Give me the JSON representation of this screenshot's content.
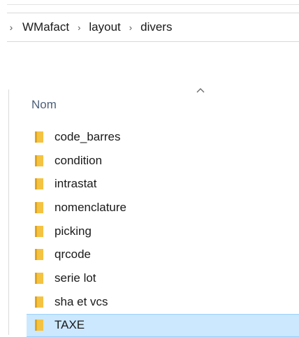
{
  "breadcrumb": {
    "items": [
      {
        "label": "WMafact"
      },
      {
        "label": "layout"
      },
      {
        "label": "divers"
      }
    ]
  },
  "column": {
    "name_header": "Nom"
  },
  "folders": [
    {
      "name": "code_barres",
      "selected": false
    },
    {
      "name": "condition",
      "selected": false
    },
    {
      "name": "intrastat",
      "selected": false
    },
    {
      "name": "nomenclature",
      "selected": false
    },
    {
      "name": "picking",
      "selected": false
    },
    {
      "name": "qrcode",
      "selected": false
    },
    {
      "name": "serie lot",
      "selected": false
    },
    {
      "name": "sha et vcs",
      "selected": false
    },
    {
      "name": "TAXE",
      "selected": true
    }
  ],
  "colors": {
    "folder": "#f5c342",
    "folder_dark": "#dfa51f",
    "selection_bg": "#cce8ff",
    "selection_border": "#99d1ff",
    "header_text": "#4c607a"
  },
  "icons": {
    "breadcrumb_separator": "chevron-right-icon",
    "sort_indicator": "chevron-up-icon",
    "folder": "folder-icon"
  }
}
